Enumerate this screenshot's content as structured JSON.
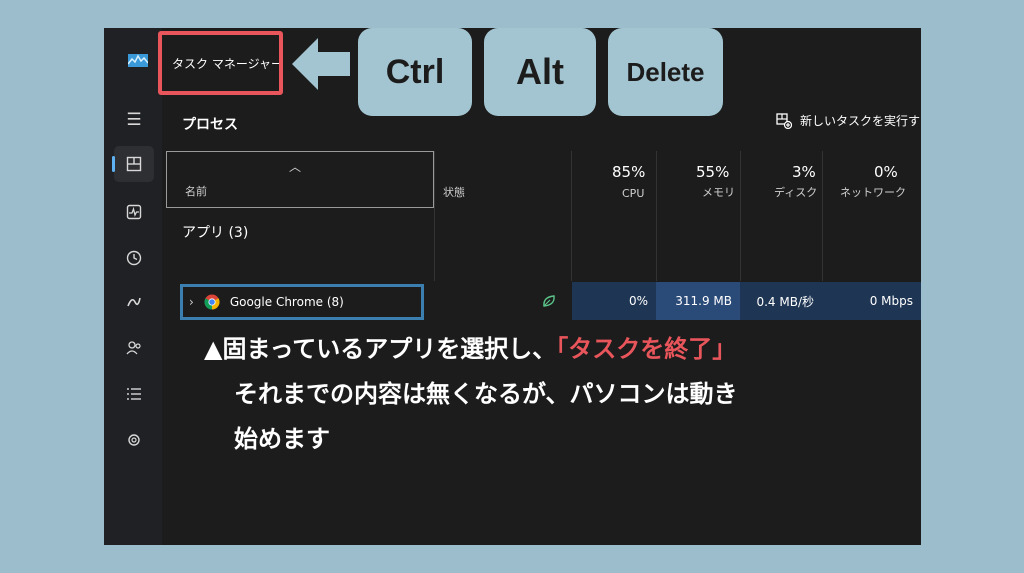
{
  "titlebar": {
    "title": "タスク マネージャー"
  },
  "keys": [
    "Ctrl",
    "Alt",
    "Delete"
  ],
  "section_title": "プロセス",
  "new_task_label": "新しいタスクを実行す",
  "columns": {
    "name": "名前",
    "status": "状態",
    "cpu": {
      "pct": "85%",
      "label": "CPU"
    },
    "memory": {
      "pct": "55%",
      "label": "メモリ"
    },
    "disk": {
      "pct": "3%",
      "label": "ディスク"
    },
    "network": {
      "pct": "0%",
      "label": "ネットワーク"
    }
  },
  "group": {
    "label": "アプリ (3)"
  },
  "process": {
    "name": "Google Chrome (8)",
    "cpu": "0%",
    "memory": "311.9 MB",
    "disk": "0.4 MB/秒",
    "network": "0 Mbps"
  },
  "caption": {
    "line1_prefix": "▲固まっているアプリを選択し、",
    "line1_highlight": "「タスクを終了」",
    "line2": "それまでの内容は無くなるが、パソコンは動き",
    "line3": "始めます"
  },
  "colors": {
    "background": "#9cbdcc",
    "accent_red": "#e8555b",
    "key_bg": "#a3c5d1",
    "highlight_blue": "#3b7fb0"
  },
  "icons": [
    "hamburger-icon",
    "processes-icon",
    "performance-icon",
    "app-history-icon",
    "startup-icon",
    "users-icon",
    "details-icon",
    "services-icon"
  ]
}
